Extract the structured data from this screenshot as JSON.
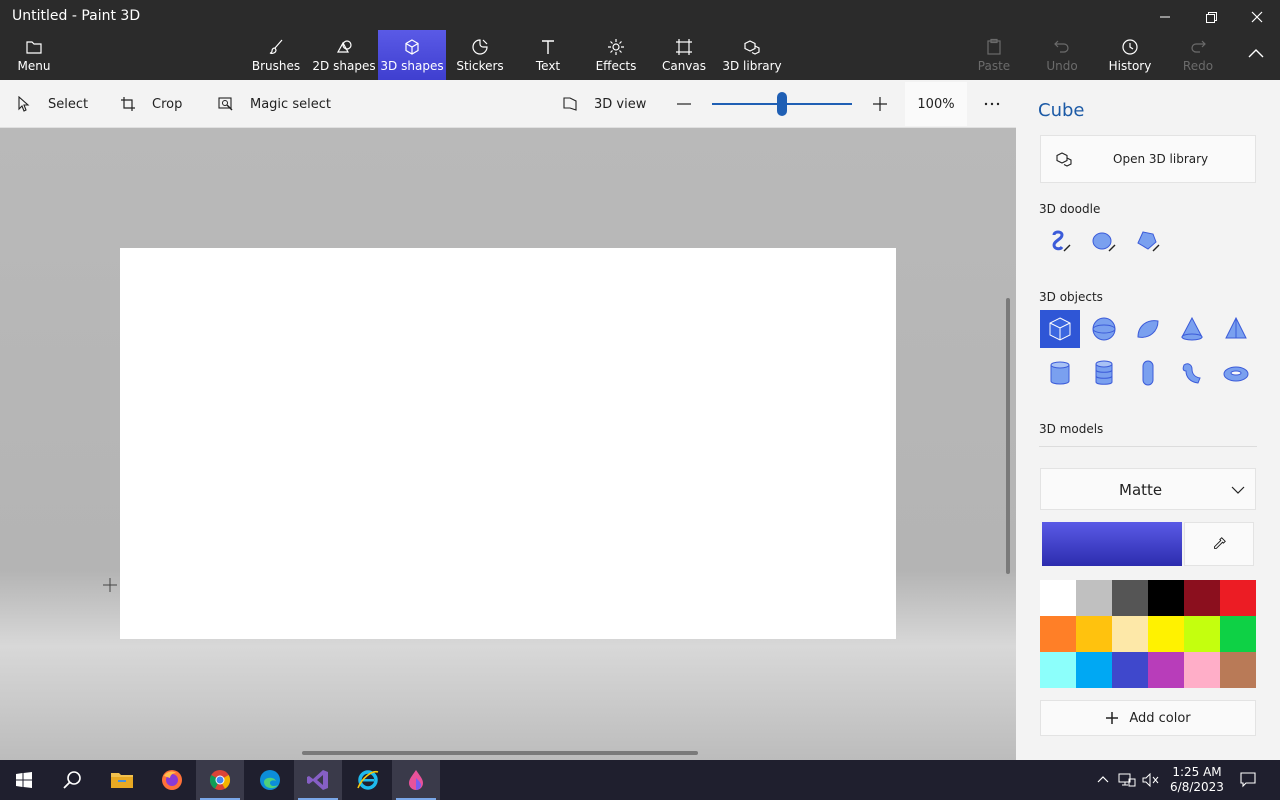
{
  "window": {
    "title": "Untitled - Paint 3D"
  },
  "ribbon": {
    "menu": "Menu",
    "tabs": [
      {
        "label": "Brushes",
        "icon": "brush-icon"
      },
      {
        "label": "2D shapes",
        "icon": "2d-shapes-icon"
      },
      {
        "label": "3D shapes",
        "icon": "3d-shapes-icon"
      },
      {
        "label": "Stickers",
        "icon": "stickers-icon"
      },
      {
        "label": "Text",
        "icon": "text-icon"
      },
      {
        "label": "Effects",
        "icon": "effects-icon"
      },
      {
        "label": "Canvas",
        "icon": "canvas-icon"
      },
      {
        "label": "3D library",
        "icon": "3d-library-icon"
      }
    ],
    "active_tab": "3D shapes",
    "actions": {
      "paste": "Paste",
      "undo": "Undo",
      "history": "History",
      "redo": "Redo"
    }
  },
  "toolbar": {
    "select": "Select",
    "crop": "Crop",
    "magic_select": "Magic select",
    "view_3d": "3D view",
    "zoom_value": 100,
    "zoom_label": "100%",
    "zoom_fraction": 0.5
  },
  "panel": {
    "title": "Cube",
    "open_library": "Open 3D library",
    "doodle_label": "3D doodle",
    "objects_label": "3D objects",
    "models_label": "3D models",
    "material": "Matte",
    "add_color": "Add color",
    "current_color": "#3f3fd0",
    "palette": [
      "#ffffff",
      "#c0c0c0",
      "#555555",
      "#000000",
      "#8b0f1e",
      "#ec1c24",
      "#ff7f27",
      "#ffc20e",
      "#fde8a8",
      "#fff200",
      "#c4ff0e",
      "#0ed145",
      "#8cfffb",
      "#00a8f3",
      "#3f48cc",
      "#b83dba",
      "#ffaec8",
      "#b97a57"
    ]
  },
  "taskbar": {
    "time": "1:25 AM",
    "date": "6/8/2023"
  }
}
